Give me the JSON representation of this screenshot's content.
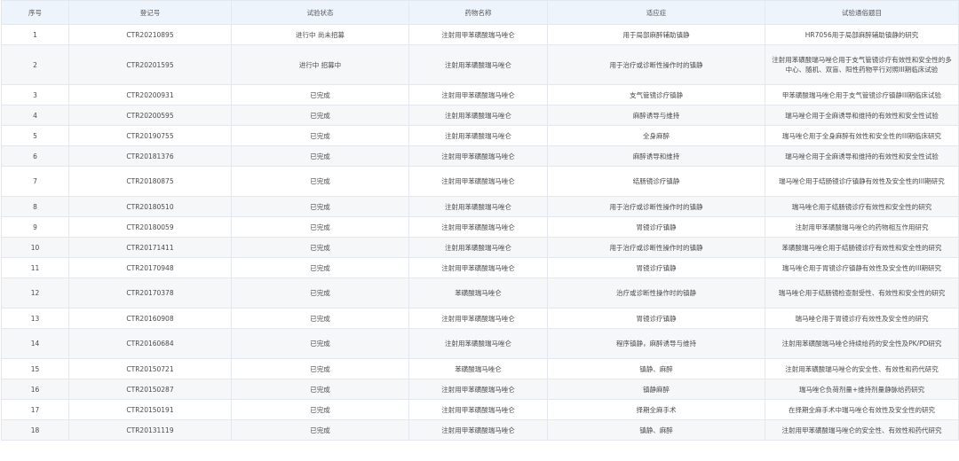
{
  "table": {
    "headers": [
      "序号",
      "登记号",
      "试验状态",
      "药物名称",
      "适应症",
      "试验通俗题目"
    ],
    "rows": [
      {
        "no": "1",
        "reg": "CTR20210895",
        "status": "进行中 尚未招募",
        "drug": "注射用甲苯磺酸瑞马唑仑",
        "indication": "用于局部麻醉辅助镇静",
        "title": "HR7056用于局部麻醉辅助镇静的研究",
        "lines": 1
      },
      {
        "no": "2",
        "reg": "CTR20201595",
        "status": "进行中 招募中",
        "drug": "注射用苯磺酸瑞马唑仑",
        "indication": "用于治疗或诊断性操作时的镇静",
        "title": "注射用苯磺酸瑞马唑仑用于支气管镜诊疗有效性和安全性的多中心、随机、双盲、阳性药物平行对照III期临床试验",
        "lines": 3
      },
      {
        "no": "3",
        "reg": "CTR20200931",
        "status": "已完成",
        "drug": "注射用甲苯磺酸瑞马唑仑",
        "indication": "支气管镜诊疗镇静",
        "title": "甲苯磺酸瑞马唑仑用于支气管镜诊疗镇静III期临床试验",
        "lines": 1
      },
      {
        "no": "4",
        "reg": "CTR20200595",
        "status": "已完成",
        "drug": "注射用苯磺酸瑞马唑仑",
        "indication": "麻醉诱导与维持",
        "title": "瑞马唑仑用于全麻诱导和维持的有效性和安全性试验",
        "lines": 1
      },
      {
        "no": "5",
        "reg": "CTR20190755",
        "status": "已完成",
        "drug": "注射用苯磺酸瑞马唑仑",
        "indication": "全身麻醉",
        "title": "瑞马唑仑用于全身麻醉有效性和安全性的III期临床研究",
        "lines": 1
      },
      {
        "no": "6",
        "reg": "CTR20181376",
        "status": "已完成",
        "drug": "注射用甲苯磺酸瑞马唑仑",
        "indication": "麻醉诱导和维持",
        "title": "瑞马唑仑用于全麻诱导和维持的有效性和安全性试验",
        "lines": 1
      },
      {
        "no": "7",
        "reg": "CTR20180875",
        "status": "已完成",
        "drug": "注射用甲苯磺酸瑞马唑仑",
        "indication": "结肠镜诊疗镇静",
        "title": "瑞马唑仑用于结肠镜诊疗镇静有效性及安全性的III期研究",
        "lines": 2
      },
      {
        "no": "8",
        "reg": "CTR20180510",
        "status": "已完成",
        "drug": "注射用苯磺酸瑞马唑仑",
        "indication": "用于治疗或诊断性操作时的镇静",
        "title": "瑞马唑仑用于结肠镜诊疗有效性和安全性的研究",
        "lines": 1
      },
      {
        "no": "9",
        "reg": "CTR20180059",
        "status": "已完成",
        "drug": "注射用甲苯磺酸瑞马唑仑",
        "indication": "胃镜诊疗镇静",
        "title": "注射用甲苯磺酸瑞马唑仑的药物相互作用研究",
        "lines": 1
      },
      {
        "no": "10",
        "reg": "CTR20171411",
        "status": "已完成",
        "drug": "注射用苯磺酸瑞马唑仑",
        "indication": "用于治疗或诊断性操作时的镇静",
        "title": "苯磺酸瑞马唑仑用于结肠镜诊疗有效性和安全性的研究",
        "lines": 1
      },
      {
        "no": "11",
        "reg": "CTR20170948",
        "status": "已完成",
        "drug": "注射用甲苯磺酸瑞马唑仑",
        "indication": "胃镜诊疗镇静",
        "title": "瑞马唑仑用于胃镜诊疗镇静有效性及安全性的III期研究",
        "lines": 1
      },
      {
        "no": "12",
        "reg": "CTR20170378",
        "status": "已完成",
        "drug": "苯磺酸瑞马唑仑",
        "indication": "治疗或诊断性操作时的镇静",
        "title": "瑞马唑仑用于结肠镜检查耐受性、有效性和安全性的研究",
        "lines": 2
      },
      {
        "no": "13",
        "reg": "CTR20160908",
        "status": "已完成",
        "drug": "注射用甲苯磺酸瑞马唑仑",
        "indication": "胃镜诊疗镇静",
        "title": "瑞马唑仑用于胃镜诊疗有效性及安全性的研究",
        "lines": 1
      },
      {
        "no": "14",
        "reg": "CTR20160684",
        "status": "已完成",
        "drug": "注射用苯磺酸瑞马唑仑",
        "indication": "程序镇静，麻醉诱导与维持",
        "title": "注射用苯磺酸瑞马唑仑持续给药的安全性及PK/PD研究",
        "lines": 2
      },
      {
        "no": "15",
        "reg": "CTR20150721",
        "status": "已完成",
        "drug": "苯磺酸瑞马唑仑",
        "indication": "镇静、麻醉",
        "title": "注射用苯磺酸瑞马唑仑的安全性、有效性和药代研究",
        "lines": 1
      },
      {
        "no": "16",
        "reg": "CTR20150287",
        "status": "已完成",
        "drug": "注射用甲苯磺酸瑞马唑仑",
        "indication": "镇静麻醉",
        "title": "瑞马唑仑负荷剂量+维持剂量静脉给药研究",
        "lines": 1
      },
      {
        "no": "17",
        "reg": "CTR20150191",
        "status": "已完成",
        "drug": "注射用甲苯磺酸瑞马唑仑",
        "indication": "择期全麻手术",
        "title": "在择期全麻手术中瑞马唑仑有效性及安全性的研究",
        "lines": 1
      },
      {
        "no": "18",
        "reg": "CTR20131119",
        "status": "已完成",
        "drug": "注射用甲苯磺酸瑞马唑仑",
        "indication": "镇静、麻醉",
        "title": "注射用甲苯磺酸瑞马唑仑的安全性、有效性和药代研究",
        "lines": 1
      }
    ]
  }
}
